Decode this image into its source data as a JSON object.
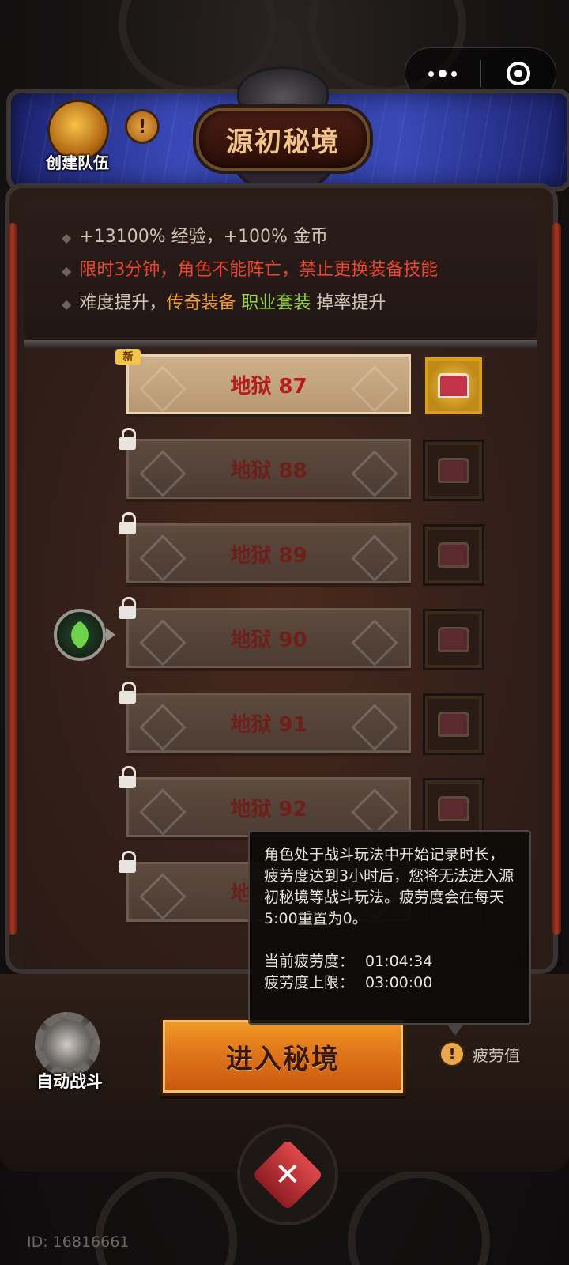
{
  "header": {
    "title": "源初秘境",
    "create_team_label": "创建队伍",
    "info_icon": "exclamation-icon"
  },
  "capsule": {
    "more_icon": "more-dots-icon",
    "close_icon": "target-circle-icon"
  },
  "info": {
    "line1": "+13100% 经验，+100% 金币",
    "line2": "限时3分钟，角色不能阵亡，禁止更换装备技能",
    "line3_prefix": "难度提升，",
    "line3_legend": "传奇装备",
    "line3_set": "职业套装",
    "line3_suffix": " 掉率提升"
  },
  "levels": [
    {
      "label": "地狱 87",
      "locked": false,
      "tag": "新"
    },
    {
      "label": "地狱 88",
      "locked": true
    },
    {
      "label": "地狱 89",
      "locked": true
    },
    {
      "label": "地狱 90",
      "locked": true
    },
    {
      "label": "地狱 91",
      "locked": true
    },
    {
      "label": "地狱 92",
      "locked": true
    },
    {
      "label": "地狱 93",
      "locked": true
    }
  ],
  "footer": {
    "auto_battle_label": "自动战斗",
    "enter_label": "进入秘境",
    "fatigue_label": "疲劳值"
  },
  "tooltip": {
    "description": "角色处于战斗玩法中开始记录时长，疲劳度达到3小时后，您将无法进入源初秘境等战斗玩法。疲劳度会在每天5:00重置为0。",
    "current_label": "当前疲劳度：",
    "current_value": "01:04:34",
    "max_label": "疲劳度上限：",
    "max_value": "03:00:00"
  },
  "player_id": "ID: 16816661",
  "colors": {
    "accent_red": "#e8462e",
    "legend_orange": "#f09a2c",
    "set_green": "#96d634",
    "button_orange": "#e0761a"
  }
}
